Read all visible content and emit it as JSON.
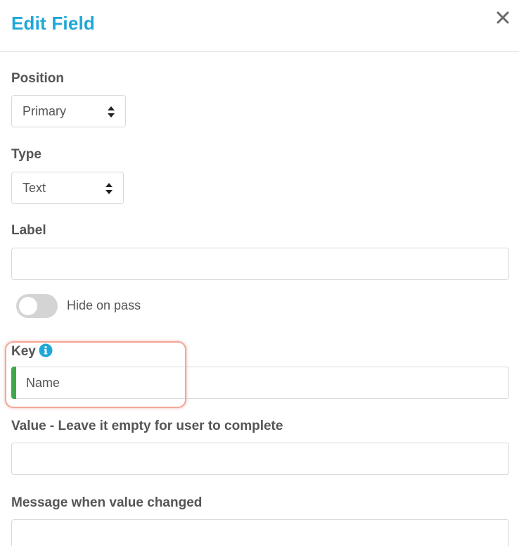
{
  "dialog": {
    "title": "Edit Field",
    "close_icon": "close-icon"
  },
  "position": {
    "label": "Position",
    "value": "Primary"
  },
  "type": {
    "label": "Type",
    "value": "Text"
  },
  "label_field": {
    "label": "Label",
    "value": ""
  },
  "hide_on_pass": {
    "label": "Hide on pass",
    "enabled": false
  },
  "key": {
    "label": "Key",
    "value": "Name",
    "info_icon": "info-icon"
  },
  "value_field": {
    "label": "Value - Leave it empty for user to complete",
    "value": ""
  },
  "message_field": {
    "label": "Message when value changed",
    "value": ""
  },
  "colors": {
    "title": "#1ea7d8",
    "info_icon": "#1ea7d8",
    "key_accent": "#3fa84a",
    "highlight": "#f2a797",
    "toggle_off": "#d4d4d4"
  }
}
